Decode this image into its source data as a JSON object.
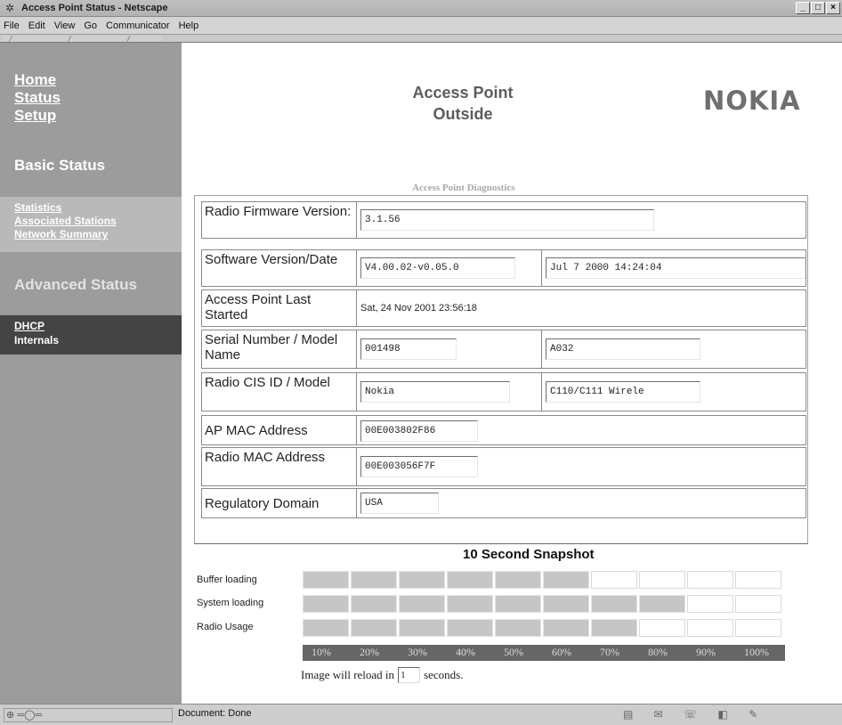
{
  "window": {
    "title": "Access Point Status - Netscape",
    "buttons": [
      "_",
      "□",
      "×"
    ]
  },
  "menu": [
    "File",
    "Edit",
    "View",
    "Go",
    "Communicator",
    "Help"
  ],
  "nav": {
    "links": [
      "Home",
      "Status",
      "Setup"
    ],
    "basic_heading": "Basic Status",
    "basic_items": [
      "Statistics",
      "Associated Stations",
      "Network Summary"
    ],
    "advanced_heading": "Advanced Status",
    "advanced_items": [
      "DHCP",
      "Internals"
    ]
  },
  "header": {
    "line1": "Access Point",
    "line2": "Outside",
    "brand": "NOKIA"
  },
  "diagnostics": {
    "title": "Access Point Diagnostics",
    "radio_firmware_label": "Radio Firmware Version:",
    "radio_firmware": "3.1.56",
    "software_label": "Software Version/Date",
    "software_version": "V4.00.02-v0.05.0",
    "software_date": "Jul  7 2000 14:24:04",
    "last_started_label": "Access Point Last Started",
    "last_started": "Sat, 24 Nov 2001 23:56:18",
    "serial_label": "Serial Number / Model Name",
    "serial": "001498",
    "model_name": "A032",
    "radio_cis_label": "Radio CIS ID / Model",
    "radio_cis": "Nokia",
    "radio_model": "C110/C111 Wirele",
    "ap_mac_label": "AP MAC Address",
    "ap_mac": "00E003802F86",
    "radio_mac_label": "Radio MAC Address",
    "radio_mac": "00E003056F7F",
    "domain_label": "Regulatory Domain",
    "domain": "USA"
  },
  "snapshot": {
    "title": "10 Second Snapshot",
    "rows": [
      {
        "label": "Buffer loading",
        "level_pct": 60
      },
      {
        "label": "System loading",
        "level_pct": 80
      },
      {
        "label": "Radio Usage",
        "level_pct": 70
      }
    ],
    "scale": [
      "10%",
      "20%",
      "30%",
      "40%",
      "50%",
      "60%",
      "70%",
      "80%",
      "90%",
      "100%"
    ],
    "reload_prefix": "Image will reload in",
    "reload_value": "1",
    "reload_suffix": "seconds."
  },
  "status": {
    "text": "Document: Done"
  }
}
